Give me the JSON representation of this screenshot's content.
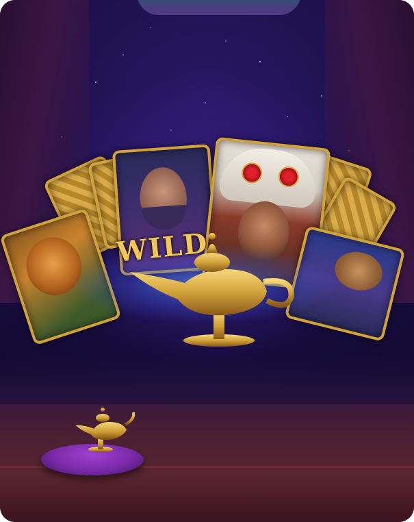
{
  "scene": {
    "card_wild_label": "WILD"
  },
  "icons": {
    "hero_lamp": "genie-lamp-icon",
    "pedestal_lamp": "genie-lamp-icon"
  },
  "colors": {
    "background": "#1a0f46",
    "gold": "#d2a23a",
    "magic_glow": "#5aaaff",
    "cushion": "#7a2aa8",
    "floor": "#4a1f34"
  }
}
